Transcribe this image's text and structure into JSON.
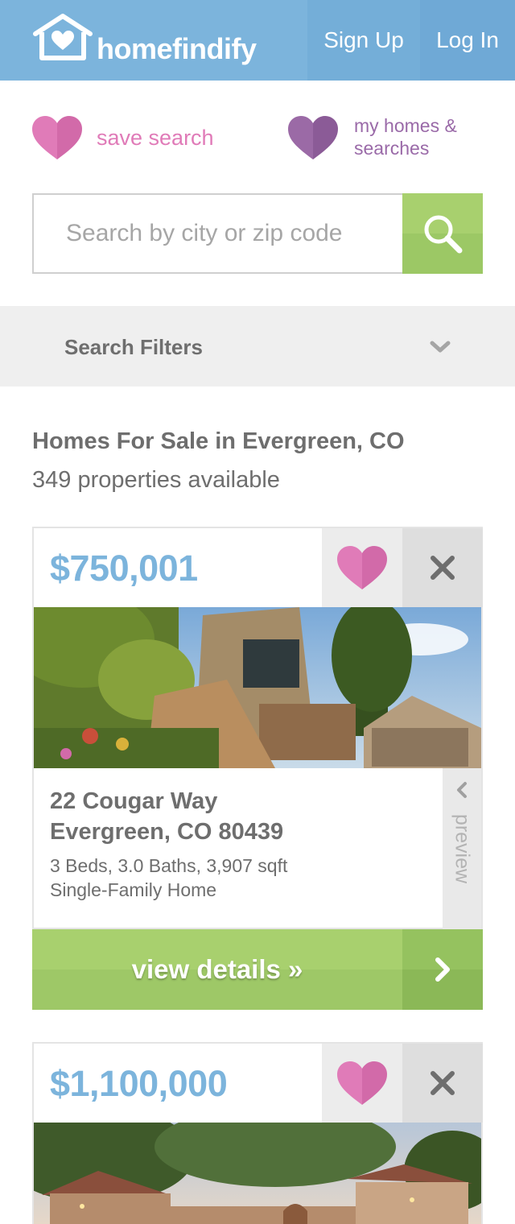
{
  "header": {
    "brand": "homefindify",
    "signup_label": "Sign Up",
    "login_label": "Log In",
    "bg_color": "#7cb4dc"
  },
  "actions": {
    "save_search_label": "save search",
    "my_homes_label": "my homes & searches",
    "save_color": "#e07bb8",
    "my_homes_color": "#9a6aa8"
  },
  "search": {
    "placeholder": "Search by city or zip code",
    "value": "",
    "button_icon": "search-icon",
    "button_color": "#a8d06e"
  },
  "filters": {
    "label": "Search Filters",
    "icon": "chevron-down-icon"
  },
  "results": {
    "title": "Homes For Sale in Evergreen, CO",
    "count": "349 properties available"
  },
  "listings": [
    {
      "price": "$750,001",
      "address_line1": "22 Cougar Way",
      "address_line2": "Evergreen, CO 80439",
      "specs": "3 Beds, 3.0 Baths, 3,907 sqft",
      "type": "Single-Family Home",
      "preview_label": "preview",
      "details_label": "view details »"
    },
    {
      "price": "$1,100,000"
    }
  ]
}
